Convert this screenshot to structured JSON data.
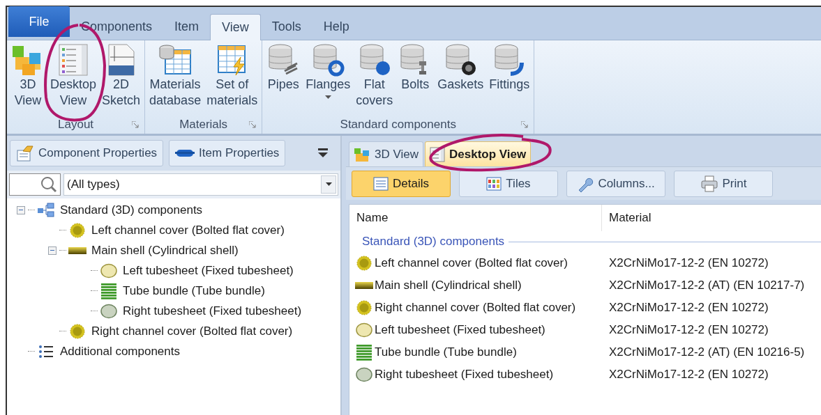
{
  "ribbon": {
    "tabs": [
      {
        "label": "File",
        "kind": "app-menu",
        "selected": false
      },
      {
        "label": "Components",
        "kind": "tab",
        "selected": false
      },
      {
        "label": "Item",
        "kind": "tab",
        "selected": false
      },
      {
        "label": "View",
        "kind": "tab",
        "selected": true
      },
      {
        "label": "Tools",
        "kind": "tab",
        "selected": false
      },
      {
        "label": "Help",
        "kind": "tab",
        "selected": false
      }
    ],
    "groups": [
      {
        "caption": "Layout",
        "launcher": true,
        "buttons": [
          {
            "label": "3D View",
            "kind": "cubes",
            "dropdown": false
          },
          {
            "label": "Desktop View",
            "kind": "list",
            "dropdown": false
          },
          {
            "label": "2D Sketch",
            "kind": "dwg",
            "dropdown": false
          }
        ]
      },
      {
        "caption": "Materials",
        "launcher": true,
        "buttons": [
          {
            "label": "Materials database",
            "kind": "db-table",
            "dropdown": false
          },
          {
            "label": "Set of materials",
            "kind": "bolt-table",
            "dropdown": false
          }
        ]
      },
      {
        "caption": "Standard components",
        "launcher": true,
        "buttons": [
          {
            "label": "Pipes",
            "kind": "pipes",
            "dropdown": false
          },
          {
            "label": "Flanges",
            "kind": "ring",
            "dropdown": true
          },
          {
            "label": "Flat covers",
            "kind": "disc",
            "dropdown": false
          },
          {
            "label": "Bolts",
            "kind": "bolt",
            "dropdown": false
          },
          {
            "label": "Gaskets",
            "kind": "gasket",
            "dropdown": false
          },
          {
            "label": "Fittings",
            "kind": "elbow",
            "dropdown": false
          }
        ]
      }
    ]
  },
  "left_pane": {
    "buttons": [
      {
        "label": "Component Properties",
        "kind": "props"
      },
      {
        "label": "Item Properties",
        "kind": "item"
      }
    ],
    "type_filter": {
      "value": "(All types)"
    },
    "tree": [
      {
        "label": "Standard (3D) components",
        "kind": "group",
        "expanded": true,
        "children": [
          {
            "label": "Left channel cover (Bolted flat cover)",
            "kind": "cover"
          },
          {
            "label": "Main shell (Cylindrical shell)",
            "kind": "shell",
            "expanded": true,
            "children": [
              {
                "label": "Left tubesheet (Fixed tubesheet)",
                "kind": "sheet-light"
              },
              {
                "label": "Tube bundle (Tube bundle)",
                "kind": "bundle"
              },
              {
                "label": "Right tubesheet (Fixed tubesheet)",
                "kind": "sheet-grey"
              }
            ]
          },
          {
            "label": "Right channel cover (Bolted flat cover)",
            "kind": "cover"
          }
        ]
      },
      {
        "label": "Additional components",
        "kind": "list"
      }
    ]
  },
  "right_pane": {
    "tabs": [
      {
        "label": "3D View",
        "kind": "cubes",
        "selected": false
      },
      {
        "label": "Desktop View",
        "kind": "list",
        "selected": true
      }
    ],
    "toolbar": [
      {
        "label": "Details",
        "kind": "details",
        "selected": true
      },
      {
        "label": "Tiles",
        "kind": "tiles",
        "selected": false
      },
      {
        "label": "Columns...",
        "kind": "wrench",
        "selected": false
      },
      {
        "label": "Print",
        "kind": "printer",
        "selected": false
      }
    ],
    "table": {
      "columns": [
        "Name",
        "Material"
      ],
      "group": "Standard (3D) components",
      "rows": [
        {
          "name": "Left channel cover (Bolted flat cover)",
          "kind": "cover",
          "material": "X2CrNiMo17-12-2 (EN 10272)"
        },
        {
          "name": "Main shell (Cylindrical shell)",
          "kind": "shell",
          "material": "X2CrNiMo17-12-2 (AT) (EN 10217-7)"
        },
        {
          "name": "Right channel cover (Bolted flat cover)",
          "kind": "cover",
          "material": "X2CrNiMo17-12-2 (EN 10272)"
        },
        {
          "name": "Left tubesheet (Fixed tubesheet)",
          "kind": "sheet-light",
          "material": "X2CrNiMo17-12-2 (EN 10272)"
        },
        {
          "name": "Tube bundle (Tube bundle)",
          "kind": "bundle",
          "material": "X2CrNiMo17-12-2 (AT) (EN 10216-5)"
        },
        {
          "name": "Right tubesheet (Fixed tubesheet)",
          "kind": "sheet-grey",
          "material": "X2CrNiMo17-12-2 (EN 10272)"
        }
      ]
    }
  }
}
